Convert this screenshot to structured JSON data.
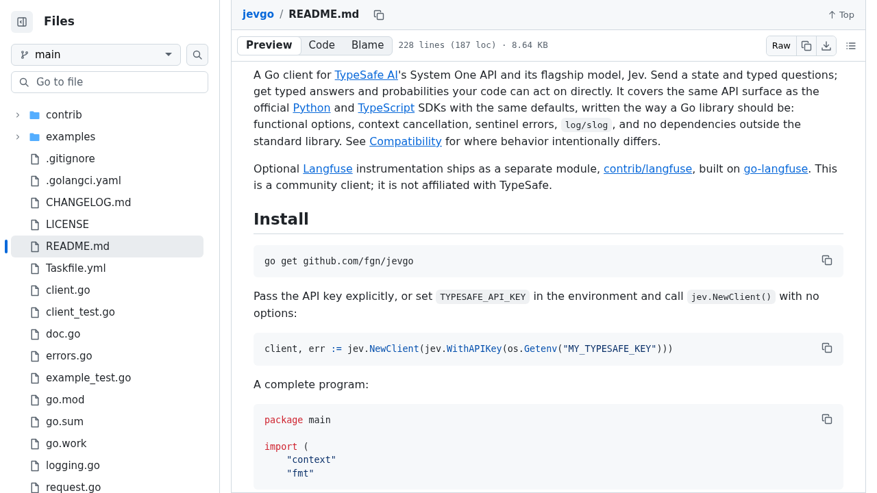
{
  "sidebar": {
    "title": "Files",
    "branch": "main",
    "search": {
      "placeholder": "Go to file"
    },
    "tree": [
      {
        "kind": "folder",
        "name": "contrib",
        "expanded": false,
        "selected": false
      },
      {
        "kind": "folder",
        "name": "examples",
        "expanded": false,
        "selected": false
      },
      {
        "kind": "file",
        "name": ".gitignore",
        "selected": false
      },
      {
        "kind": "file",
        "name": ".golangci.yaml",
        "selected": false
      },
      {
        "kind": "file",
        "name": "CHANGELOG.md",
        "selected": false
      },
      {
        "kind": "file",
        "name": "LICENSE",
        "selected": false
      },
      {
        "kind": "file",
        "name": "README.md",
        "selected": true
      },
      {
        "kind": "file",
        "name": "Taskfile.yml",
        "selected": false
      },
      {
        "kind": "file",
        "name": "client.go",
        "selected": false
      },
      {
        "kind": "file",
        "name": "client_test.go",
        "selected": false
      },
      {
        "kind": "file",
        "name": "doc.go",
        "selected": false
      },
      {
        "kind": "file",
        "name": "errors.go",
        "selected": false
      },
      {
        "kind": "file",
        "name": "example_test.go",
        "selected": false
      },
      {
        "kind": "file",
        "name": "go.mod",
        "selected": false
      },
      {
        "kind": "file",
        "name": "go.sum",
        "selected": false
      },
      {
        "kind": "file",
        "name": "go.work",
        "selected": false
      },
      {
        "kind": "file",
        "name": "logging.go",
        "selected": false
      },
      {
        "kind": "file",
        "name": "request.go",
        "selected": false
      }
    ]
  },
  "breadcrumb": {
    "repo": "jevgo",
    "separator": "/",
    "file": "README.md"
  },
  "top_link": "Top",
  "view_tabs": [
    {
      "label": "Preview",
      "selected": true
    },
    {
      "label": "Code",
      "selected": false
    },
    {
      "label": "Blame",
      "selected": false
    }
  ],
  "file_info": "228 lines (187 loc) · 8.64 KB",
  "raw_button": "Raw",
  "content": [
    {
      "kind": "paragraph",
      "segments": [
        {
          "kind": "text",
          "text": "A Go client for "
        },
        {
          "kind": "link",
          "text": "TypeSafe AI"
        },
        {
          "kind": "text",
          "text": "'s System One API and its flagship model, Jev. Send a state and typed questions; get typed answers and probabilities your code can act on directly. It covers the same API surface as the official "
        },
        {
          "kind": "link",
          "text": "Python"
        },
        {
          "kind": "text",
          "text": " and "
        },
        {
          "kind": "link",
          "text": "TypeScript"
        },
        {
          "kind": "text",
          "text": " SDKs with the same defaults, written the way a Go library should be: functional options, context cancellation, sentinel errors, "
        },
        {
          "kind": "code",
          "text": "log/slog"
        },
        {
          "kind": "text",
          "text": ", and no dependencies outside the standard library. See "
        },
        {
          "kind": "link",
          "text": "Compatibility"
        },
        {
          "kind": "text",
          "text": " for where behavior intentionally differs."
        }
      ]
    },
    {
      "kind": "paragraph",
      "segments": [
        {
          "kind": "text",
          "text": "Optional "
        },
        {
          "kind": "link",
          "text": "Langfuse"
        },
        {
          "kind": "text",
          "text": " instrumentation ships as a separate module, "
        },
        {
          "kind": "link",
          "text": "contrib/langfuse"
        },
        {
          "kind": "text",
          "text": ", built on "
        },
        {
          "kind": "link",
          "text": "go-langfuse"
        },
        {
          "kind": "text",
          "text": ". This is a community client; it is not affiliated with TypeSafe."
        }
      ]
    },
    {
      "kind": "heading",
      "text": "Install"
    },
    {
      "kind": "codeblock",
      "lines": [
        {
          "kind": "code",
          "tokens": [
            {
              "kind": "plain",
              "text": "go get github.com/fgn/jevgo"
            }
          ]
        }
      ]
    },
    {
      "kind": "paragraph",
      "segments": [
        {
          "kind": "text",
          "text": "Pass the API key explicitly, or set "
        },
        {
          "kind": "code",
          "text": "TYPESAFE_API_KEY"
        },
        {
          "kind": "text",
          "text": " in the environment and call "
        },
        {
          "kind": "code",
          "text": "jev.NewClient()"
        },
        {
          "kind": "text",
          "text": " with no options:"
        }
      ]
    },
    {
      "kind": "codeblock",
      "lines": [
        {
          "kind": "code",
          "tokens": [
            {
              "kind": "plain",
              "text": "client, err "
            },
            {
              "kind": "operator",
              "text": ":="
            },
            {
              "kind": "plain",
              "text": " jev."
            },
            {
              "kind": "func",
              "text": "NewClient"
            },
            {
              "kind": "plain",
              "text": "(jev."
            },
            {
              "kind": "func",
              "text": "WithAPIKey"
            },
            {
              "kind": "plain",
              "text": "(os."
            },
            {
              "kind": "func",
              "text": "Getenv"
            },
            {
              "kind": "plain",
              "text": "("
            },
            {
              "kind": "string",
              "text": "\"MY_TYPESAFE_KEY\""
            },
            {
              "kind": "plain",
              "text": ")))"
            }
          ]
        }
      ]
    },
    {
      "kind": "paragraph",
      "segments": [
        {
          "kind": "text",
          "text": "A complete program:"
        }
      ]
    },
    {
      "kind": "codeblock",
      "lines": [
        {
          "kind": "code",
          "tokens": [
            {
              "kind": "keyword",
              "text": "package"
            },
            {
              "kind": "plain",
              "text": " main"
            }
          ]
        },
        {
          "kind": "blank"
        },
        {
          "kind": "code",
          "tokens": [
            {
              "kind": "keyword",
              "text": "import"
            },
            {
              "kind": "plain",
              "text": " ("
            }
          ]
        },
        {
          "kind": "code",
          "tokens": [
            {
              "kind": "string",
              "text": "    \"context\""
            }
          ]
        },
        {
          "kind": "code",
          "tokens": [
            {
              "kind": "string",
              "text": "    \"fmt\""
            }
          ]
        }
      ]
    }
  ]
}
